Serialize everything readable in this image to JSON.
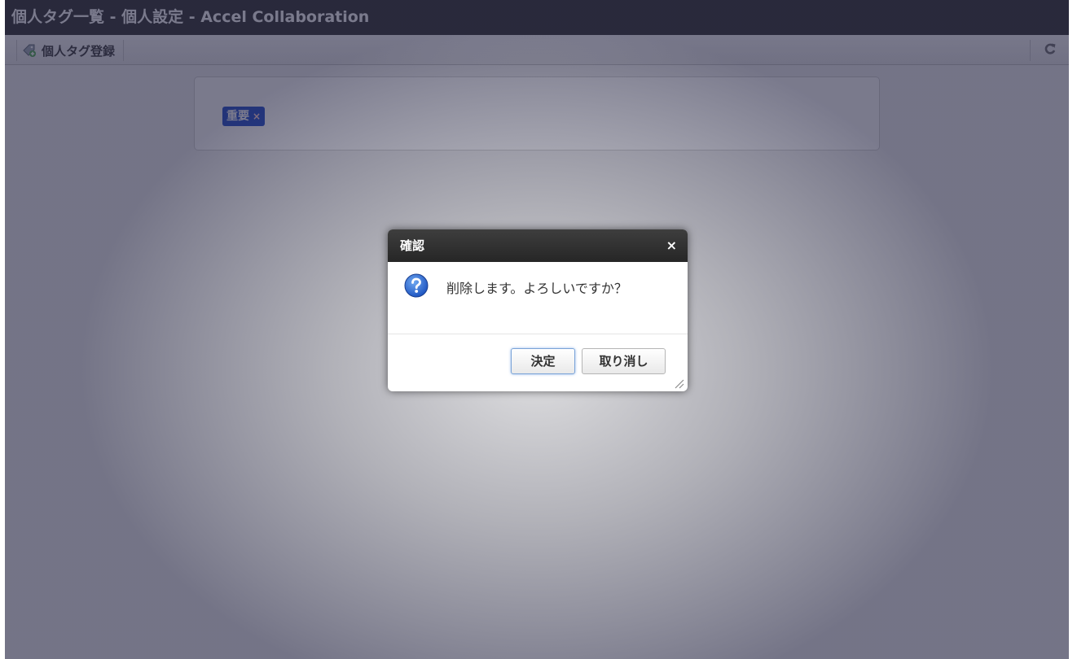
{
  "window": {
    "title": "個人タグ一覧 - 個人設定 - Accel Collaboration"
  },
  "toolbar": {
    "register_label": "個人タグ登録",
    "register_icon": "tag-add-icon",
    "refresh_icon": "refresh-icon"
  },
  "tags": [
    {
      "label": "重要",
      "remove_label": "×",
      "color": "#1a46c8"
    }
  ],
  "dialog": {
    "title": "確認",
    "close_label": "×",
    "icon": "question-icon",
    "message": "削除します。よろしいですか？",
    "ok_label": "決定",
    "cancel_label": "取り消し"
  },
  "colors": {
    "titlebar": "#2a2a2a",
    "dialog_header": "#2e2e2e",
    "tag": "#1a46c8",
    "question_icon": "#2f6fd6"
  }
}
